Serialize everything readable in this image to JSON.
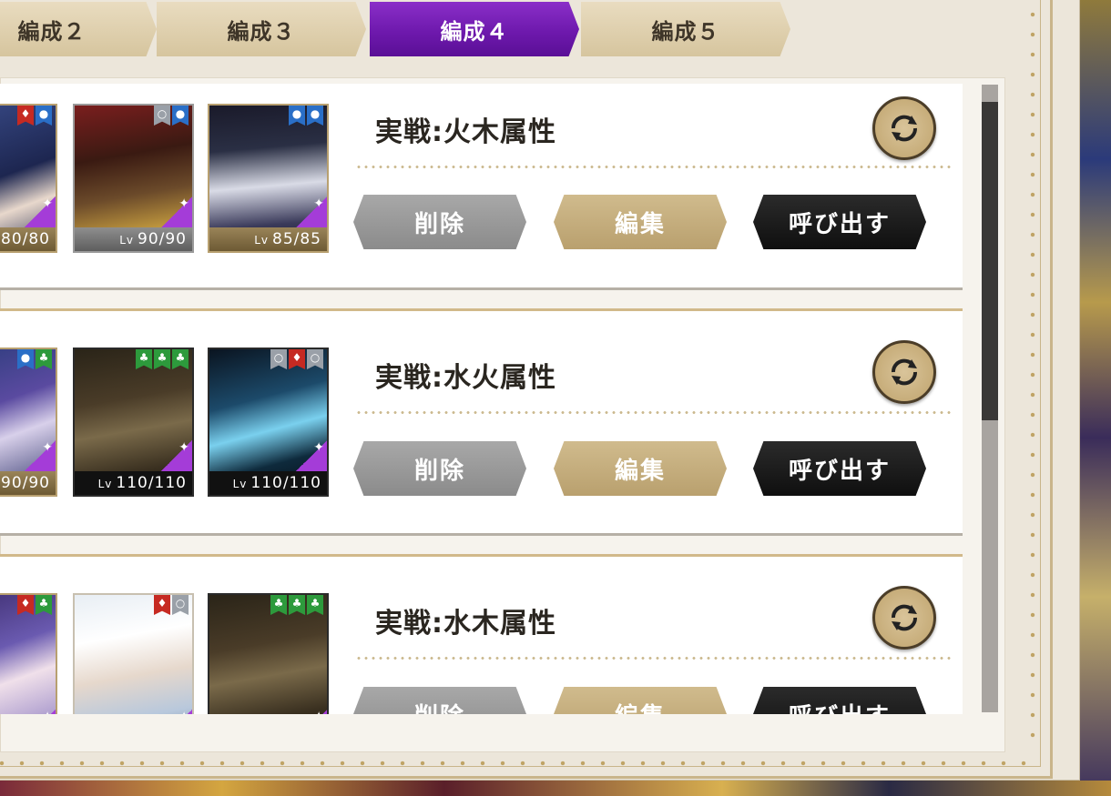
{
  "tabs": [
    {
      "label": "編成２",
      "active": false
    },
    {
      "label": "編成３",
      "active": false
    },
    {
      "label": "編成４",
      "active": true
    },
    {
      "label": "編成５",
      "active": false
    }
  ],
  "buttons": {
    "delete": "削除",
    "edit": "編集",
    "call": "呼び出す"
  },
  "teams": [
    {
      "name": "実戦:火木属性",
      "members": [
        {
          "level": "80/80",
          "attrs": [
            "fire",
            "water"
          ]
        },
        {
          "level": "90/90",
          "lv_label": "Lv",
          "attrs": [
            "none",
            "water"
          ]
        },
        {
          "level": "85/85",
          "lv_label": "Lv",
          "attrs": [
            "water",
            "water"
          ]
        }
      ]
    },
    {
      "name": "実戦:水火属性",
      "members": [
        {
          "level": "90/90",
          "attrs": [
            "water",
            "wood"
          ]
        },
        {
          "level": "110/110",
          "lv_label": "Lv",
          "attrs": [
            "wood",
            "wood",
            "wood"
          ]
        },
        {
          "level": "110/110",
          "lv_label": "Lv",
          "attrs": [
            "none",
            "fire",
            "none"
          ]
        }
      ]
    },
    {
      "name": "実戦:水木属性",
      "members": [
        {
          "level": "",
          "attrs": [
            "fire",
            "wood"
          ]
        },
        {
          "level": "",
          "attrs": [
            "fire",
            "none"
          ]
        },
        {
          "level": "",
          "attrs": [
            "wood",
            "wood",
            "wood"
          ]
        }
      ]
    }
  ],
  "colors": {
    "active_tab": "#7a22b8",
    "fire": "#c62a22",
    "water": "#2a6fc7",
    "wood": "#2d9a3c"
  }
}
